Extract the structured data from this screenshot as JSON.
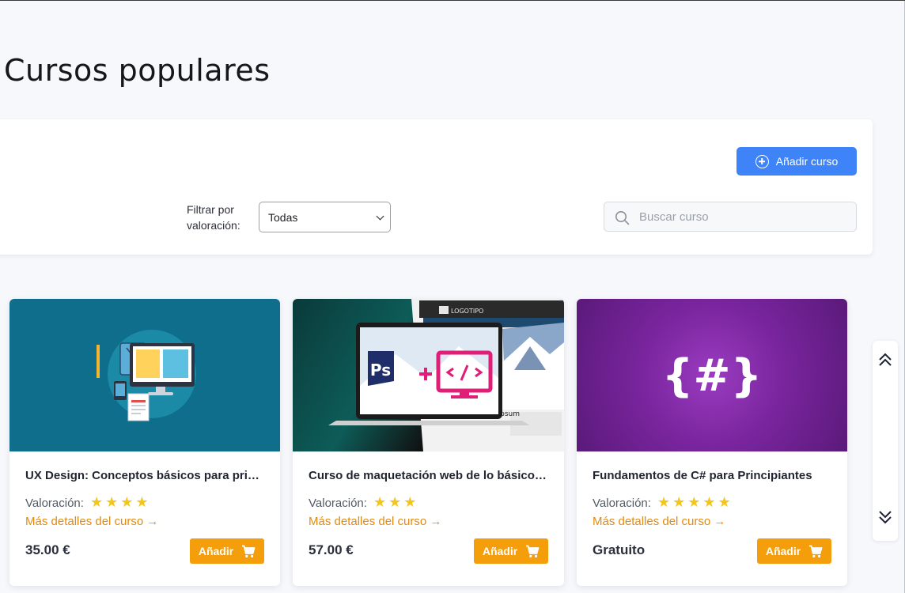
{
  "page": {
    "title": "Cursos populares"
  },
  "toolbar": {
    "add_course_label": "Añadir curso",
    "filter_label": "Filtrar por valoración:",
    "filter_selected": "Todas",
    "search_placeholder": "Buscar curso"
  },
  "courses": [
    {
      "title": "UX Design: Conceptos básicos para princip...",
      "rating_label": "Valoración:",
      "stars": 4,
      "details_link": "Más detalles del curso →",
      "price": "35.00 €",
      "buy_label": "Añadir",
      "image_icon": "ux-design-illustration"
    },
    {
      "title": "Curso de maquetación web de lo básico a ...",
      "rating_label": "Valoración:",
      "stars": 3,
      "details_link": "Más detalles del curso →",
      "price": "57.00 €",
      "buy_label": "Añadir",
      "image_icon": "photoshop-plus-code-illustration",
      "image_text": {
        "ps": "Ps",
        "logo": "LOGOTIPO",
        "lorem": "m ipsum"
      }
    },
    {
      "title": "Fundamentos de C# para Principiantes",
      "rating_label": "Valoración:",
      "stars": 5,
      "details_link": "Más detalles del curso →",
      "price": "Gratuito",
      "buy_label": "Añadir",
      "image_icon": "csharp-hash-braces-illustration",
      "image_text": {
        "hash": "{#}"
      }
    }
  ],
  "colors": {
    "accent_blue": "#3e83f8",
    "accent_orange": "#f59e0b",
    "link_orange": "#e48a10",
    "star_yellow": "#f5c518"
  }
}
